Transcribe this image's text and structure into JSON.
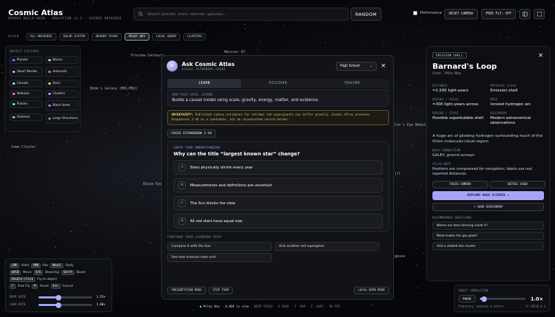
{
  "app": {
    "title": "Cosmic Atlas",
    "subtitle": "OPENAI BUILD WEEK · EDUCATION v1.2 · GUIDED UNIVERSE"
  },
  "search": {
    "placeholder": "Search planets, stars, nebulae, galaxies..."
  },
  "header": {
    "random": "RANDOM",
    "performance": "Performance",
    "reset_camera": "RESET CAMERA",
    "free_fly": "FREE FLY: OFF",
    "panel_icon": "panel-icon",
    "fullscreen_icon": "fullscreen-icon"
  },
  "scale": {
    "label": "SCALE",
    "options": [
      "ALL UNIVERSE",
      "SOLAR SYSTEM",
      "NEARBY STARS",
      "MILKY WAY",
      "LOCAL GROUP",
      "CLUSTERS"
    ],
    "active": "MILKY WAY"
  },
  "filters": {
    "title": "OBJECT FILTERS",
    "items": [
      {
        "label": "Planets",
        "color": "#5b8dff"
      },
      {
        "label": "Moons",
        "color": "#c9c9c9"
      },
      {
        "label": "Dwarf Worlds",
        "color": "#c0a7ff"
      },
      {
        "label": "Asteroids",
        "color": "#b58e64"
      },
      {
        "label": "Comets",
        "color": "#7fe3ff"
      },
      {
        "label": "Stars",
        "color": "#ffc64d"
      },
      {
        "label": "Nebulae",
        "color": "#ff7ab8"
      },
      {
        "label": "Clusters",
        "color": "#9aa6ff"
      },
      {
        "label": "Pulsars",
        "color": "#5ff0d0"
      },
      {
        "label": "Black Holes",
        "color": "#a779ff"
      },
      {
        "label": "Galaxies",
        "color": "#8cb4ff"
      },
      {
        "label": "Large Structures",
        "color": "#7f8aa0"
      }
    ]
  },
  "space_labels": [
    "Proxima Centauri",
    "Messier 87",
    "Bode's Galaxy (M81/M82)",
    "Coma Cluster",
    "Black Eye",
    "Cat's Eye Nebula (NGC 654",
    "(f)",
    "geuse"
  ],
  "controls": {
    "rows": [
      [
        {
          "k": "LMB"
        },
        {
          "t": "Orbit"
        },
        {
          "k": "RMB"
        },
        {
          "t": "Pan"
        },
        {
          "k": "Wheel"
        },
        {
          "t": "Dolly"
        }
      ],
      [
        {
          "k": "WASD"
        },
        {
          "t": "Move"
        },
        {
          "k": "Q/E"
        },
        {
          "t": "Down/Up"
        },
        {
          "k": "Shift"
        },
        {
          "t": "Boost"
        }
      ],
      [
        {
          "k": "Double-click"
        },
        {
          "t": "Fly to object"
        }
      ],
      [
        {
          "k": "F"
        },
        {
          "t": "Free Fly"
        },
        {
          "k": "R"
        },
        {
          "t": "Reset"
        },
        {
          "k": "Esc"
        },
        {
          "t": "Cancel"
        }
      ]
    ],
    "move_rate": {
      "label": "MOVE RATE",
      "value": "1.55×",
      "fraction": 0.37
    },
    "look_rate": {
      "label": "LOOK RATE",
      "value": "1.00×",
      "fraction": 0.37
    }
  },
  "status": {
    "main": "Milky Way · 0,000 ly view",
    "detail": "· DEEP FIELD · X 5502 · Y -569 · Z -1467 · 30 FPS"
  },
  "learn": {
    "title": "Ask Cosmic Atlas",
    "subtitle": "VISUAL ASTRONOMY GUIDE",
    "level": "High School",
    "tabs": [
      "LEARN",
      "DISCOVER",
      "TEACHER"
    ],
    "active_tab": "LEARN",
    "level_heading": "HOW THIS LEVEL LEARNS",
    "level_text": "Builds a causal model using scale, gravity, energy, matter, and evidence.",
    "uncertainty_label": "UNCERTAINTY:",
    "uncertainty_text": "Published radius estimates for extreme red supergiants can differ greatly. Cosmic Atlas presents Stephenson 2-18 as a candidate, not an uncontested record holder.",
    "focus_button": "FOCUS STEPHENSON 2-18",
    "check_heading": "CHECK YOUR UNDERSTANDING",
    "question": "Why can the title “largest known star” change?",
    "answers": [
      {
        "letter": "A",
        "text": "Stars physically shrink every year"
      },
      {
        "letter": "B",
        "text": "Measurements and definitions are uncertain"
      },
      {
        "letter": "C",
        "text": "The Sun blocks the view"
      },
      {
        "letter": "D",
        "text": "All red stars have equal size"
      }
    ],
    "continue_heading": "CONTINUE YOUR LEARNING PATH",
    "continue_items": [
      "Compare it with the Sun",
      "Visit another red supergiant",
      "See how massive stars end"
    ],
    "footer": {
      "presentation": "PRESENTATION MODE",
      "stop_tour": "STOP TOUR",
      "local_demo": "LOCAL DEMO MODE"
    }
  },
  "detail": {
    "badge": "EMISSION SHELL",
    "title": "Barnard's Loop",
    "subtitle": "Orion · Milky Way",
    "facts": [
      {
        "k": "DISTANCE",
        "v": "≈1,500 light-years"
      },
      {
        "k": "PHYSICAL CLASS",
        "v": "Emission shell"
      },
      {
        "k": "RADIUS / SCALE",
        "v": "≈300 light-years across"
      },
      {
        "k": "MASS",
        "v": "Ionized hydrogen arc"
      },
      {
        "k": "PERIOD / STATE",
        "v": "Possible superbubble shell"
      },
      {
        "k": "DISCOVERY",
        "v": "Modern astronomical observations"
      }
    ],
    "description": "A huge arc of glowing hydrogen surrounding much of the Orion molecular-cloud region.",
    "nasa_heading": "NASA CONNECTION",
    "nasa_text": "GALEX; ground surveys",
    "atlas_heading": "ATLAS NOTE",
    "atlas_text": "Positions are compressed for navigation; labels use real reported distances.",
    "focus_camera": "FOCUS CAMERA",
    "detail_view": "DETAIL VIEW",
    "explore": "EXPLORE NASA SCIENCE ↗",
    "save": "+ SAVE DISCOVERY",
    "rec_heading": "RECOMMENDED QUESTIONS",
    "questions": [
      "Where are stars forming inside it?",
      "What makes the gas glow?",
      "Visit a related star cluster"
    ]
  },
  "orbit": {
    "title": "ORBIT SIMULATION",
    "pause": "PAUSE",
    "value": "1.0×",
    "fraction": 0.1,
    "caption": "Planetary rotation & orbits",
    "time": "T+ 19536.9 d"
  }
}
